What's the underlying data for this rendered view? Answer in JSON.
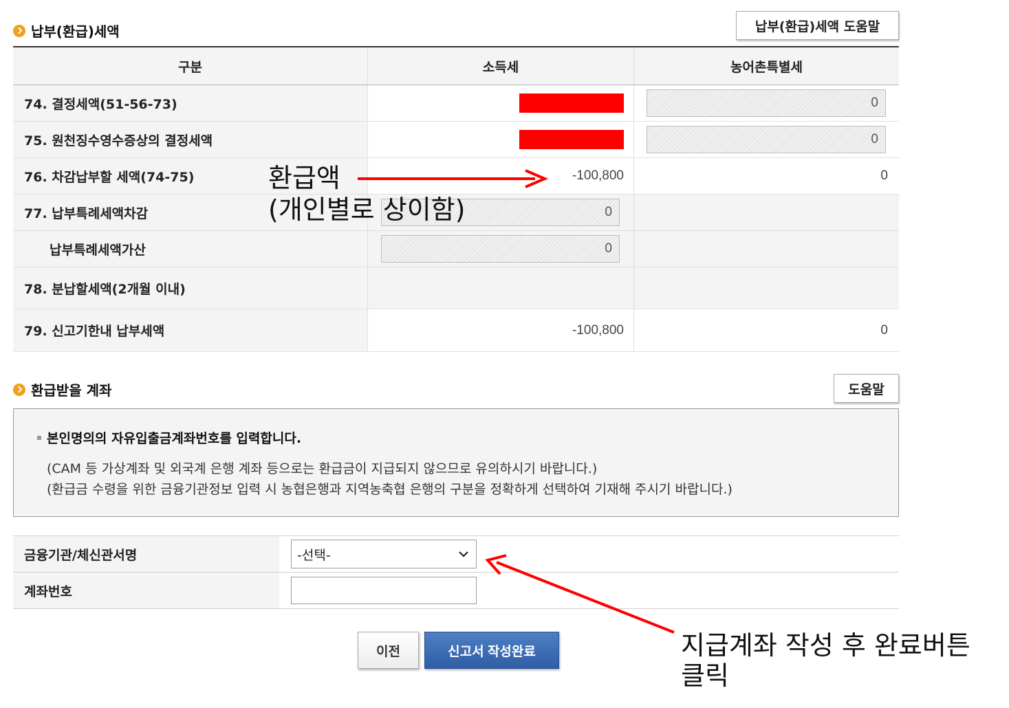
{
  "tax_section": {
    "title": "납부(환급)세액",
    "help_label": "납부(환급)세액 도움말",
    "headers": [
      "구분",
      "소득세",
      "농어촌특별세"
    ],
    "rows": [
      {
        "label": "74. 결정세액(51-56-73)",
        "income_tax": "",
        "rural_tax": "0"
      },
      {
        "label": "75. 원천징수영수증상의 결정세액",
        "income_tax": "",
        "rural_tax": "0"
      },
      {
        "label": "76. 차감납부할 세액(74-75)",
        "income_tax": "-100,800",
        "rural_tax": "0"
      },
      {
        "label": "77. 납부특례세액차감",
        "income_tax": "0",
        "rural_tax": ""
      },
      {
        "label": "납부특례세액가산",
        "income_tax": "0",
        "rural_tax": ""
      },
      {
        "label": "78. 분납할세액(2개월 이내)",
        "income_tax": "",
        "rural_tax": ""
      },
      {
        "label": "79. 신고기한내 납부세액",
        "income_tax": "-100,800",
        "rural_tax": "0"
      }
    ]
  },
  "refund_section": {
    "title": "환급받을 계좌",
    "help_label": "도움말",
    "notice_main": "본인명의의 자유입출금계좌번호를 입력합니다.",
    "notice_line1": "(CAM 등 가상계좌 및 외국계 은행 계좌 등으로는 환급금이 지급되지 않으므로 유의하시기 바랍니다.)",
    "notice_line2": "(환급금 수령을 위한 금융기관정보 입력 시 농협은행과 지역농축협 은행의 구분을 정확하게 선택하여 기재해 주시기 바랍니다.)",
    "bank_label": "금융기관/체신관서명",
    "bank_selected": "-선택-",
    "account_label": "계좌번호",
    "account_value": ""
  },
  "buttons": {
    "prev": "이전",
    "complete": "신고서 작성완료"
  },
  "annotations": {
    "refund_line1": "환급액",
    "refund_line2": "(개인별로 상이함)",
    "click_line1": "지급계좌 작성 후 완료버튼",
    "click_line2": "클릭",
    "arrow_color": "#ff0000"
  },
  "colors": {
    "accent_bullet": "#f0a01c",
    "primary_button": "#2d5ea6",
    "redaction": "#ff0000"
  }
}
